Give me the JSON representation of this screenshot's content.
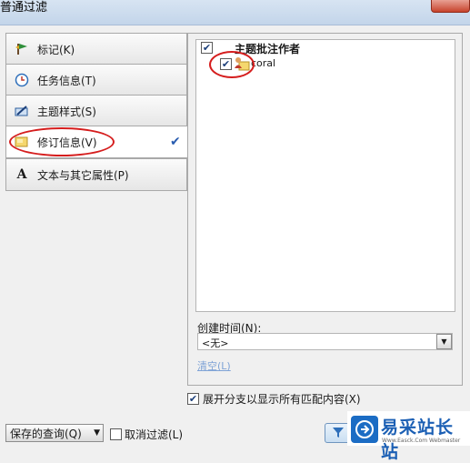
{
  "window": {
    "title": "普通过滤"
  },
  "nav": {
    "items": [
      {
        "label": "标记(K)",
        "icon": "flag-icon"
      },
      {
        "label": "任务信息(T)",
        "icon": "clock-icon"
      },
      {
        "label": "主题样式(S)",
        "icon": "brush-icon"
      },
      {
        "label": "修订信息(V)",
        "icon": "note-icon",
        "selected": true,
        "check": "✔"
      },
      {
        "label": "文本与其它属性(P)",
        "icon": "text-a-icon"
      }
    ]
  },
  "tree": {
    "header": "主题批注作者",
    "header_checked": "✔",
    "user": {
      "name": "coral",
      "checked": "✔"
    }
  },
  "created_time": {
    "label": "创建时间(N):",
    "value": "<无>",
    "clear_label": "清空(L)"
  },
  "expand": {
    "label": "展开分支以显示所有匹配内容(X)",
    "checked": "✔"
  },
  "bottom": {
    "saved_query_label": "保存的查询(Q)",
    "cancel_filter_label": "取消过滤(L)"
  },
  "watermark": {
    "title": "易采站长站",
    "subtitle": "Www.Easck.Com Webmaster"
  },
  "colors": {
    "annotation": "#d51d1d",
    "accent": "#1b6cc4"
  }
}
